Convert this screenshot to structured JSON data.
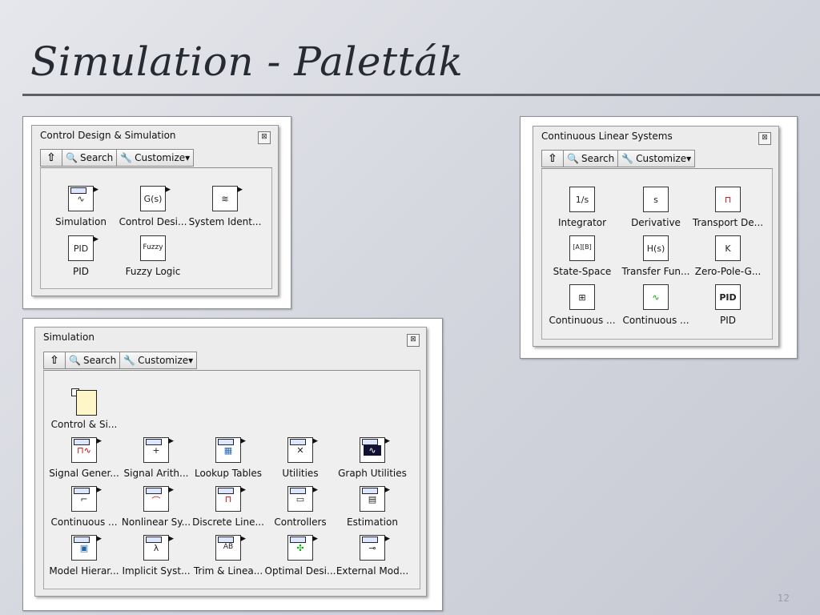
{
  "slide": {
    "title": "Simulation - Paletták",
    "number": "12"
  },
  "palettes": {
    "control_design": {
      "title": "Control Design & Simulation",
      "toolbar": {
        "search": "Search",
        "customize": "Customize▾"
      },
      "items": [
        {
          "label": "Simulation",
          "icon": "simulation-icon",
          "glyph": "∿"
        },
        {
          "label": "Control Desi...",
          "icon": "control-design-icon",
          "glyph": "G(s)"
        },
        {
          "label": "System Ident...",
          "icon": "system-identification-icon",
          "glyph": "≋"
        },
        {
          "label": "PID",
          "icon": "pid-icon",
          "glyph": "PID"
        },
        {
          "label": "Fuzzy Logic",
          "icon": "fuzzy-logic-icon",
          "glyph": "Fuzzy"
        }
      ]
    },
    "continuous_linear": {
      "title": "Continuous Linear Systems",
      "toolbar": {
        "search": "Search",
        "customize": "Customize▾"
      },
      "items": [
        {
          "label": "Integrator",
          "icon": "integrator-icon",
          "glyph": "1/s"
        },
        {
          "label": "Derivative",
          "icon": "derivative-icon",
          "glyph": "s"
        },
        {
          "label": "Transport De...",
          "icon": "transport-delay-icon",
          "glyph": "⊓"
        },
        {
          "label": "State-Space",
          "icon": "state-space-icon",
          "glyph": "[A][B]"
        },
        {
          "label": "Transfer Fun...",
          "icon": "transfer-function-icon",
          "glyph": "H(s)"
        },
        {
          "label": "Zero-Pole-G...",
          "icon": "zero-pole-gain-icon",
          "glyph": "K"
        },
        {
          "label": "Continuous ...",
          "icon": "continuous-icon-1",
          "glyph": "⊞"
        },
        {
          "label": "Continuous ...",
          "icon": "continuous-icon-2",
          "glyph": "∿"
        },
        {
          "label": "PID",
          "icon": "pid-icon",
          "glyph": "PID"
        }
      ]
    },
    "simulation": {
      "title": "Simulation",
      "toolbar": {
        "search": "Search",
        "customize": "Customize▾"
      },
      "items": [
        {
          "label": "Control & Si...",
          "icon": "control-and-simulation-loop-icon",
          "glyph": ""
        },
        {
          "label": "Signal Gener...",
          "icon": "signal-generation-icon",
          "glyph": "⊓∿"
        },
        {
          "label": "Signal Arith...",
          "icon": "signal-arithmetic-icon",
          "glyph": "+"
        },
        {
          "label": "Lookup Tables",
          "icon": "lookup-tables-icon",
          "glyph": "▦"
        },
        {
          "label": "Utilities",
          "icon": "utilities-icon",
          "glyph": "✕"
        },
        {
          "label": "Graph Utilities",
          "icon": "graph-utilities-icon",
          "glyph": "∿"
        },
        {
          "label": "Continuous ...",
          "icon": "continuous-icon",
          "glyph": "⌐"
        },
        {
          "label": "Nonlinear Sy...",
          "icon": "nonlinear-systems-icon",
          "glyph": "⌒"
        },
        {
          "label": "Discrete Line...",
          "icon": "discrete-linear-icon",
          "glyph": "⊓"
        },
        {
          "label": "Controllers",
          "icon": "controllers-icon",
          "glyph": "▭"
        },
        {
          "label": "Estimation",
          "icon": "estimation-icon",
          "glyph": "▤"
        },
        {
          "label": "Model Hierar...",
          "icon": "model-hierarchy-icon",
          "glyph": "▣"
        },
        {
          "label": "Implicit Syst...",
          "icon": "implicit-system-icon",
          "glyph": "λ"
        },
        {
          "label": "Trim & Linea...",
          "icon": "trim-linearize-icon",
          "glyph": "AB"
        },
        {
          "label": "Optimal Desi...",
          "icon": "optimal-design-icon",
          "glyph": "✣"
        },
        {
          "label": "External Mod...",
          "icon": "external-model-icon",
          "glyph": "⊸"
        }
      ]
    }
  }
}
